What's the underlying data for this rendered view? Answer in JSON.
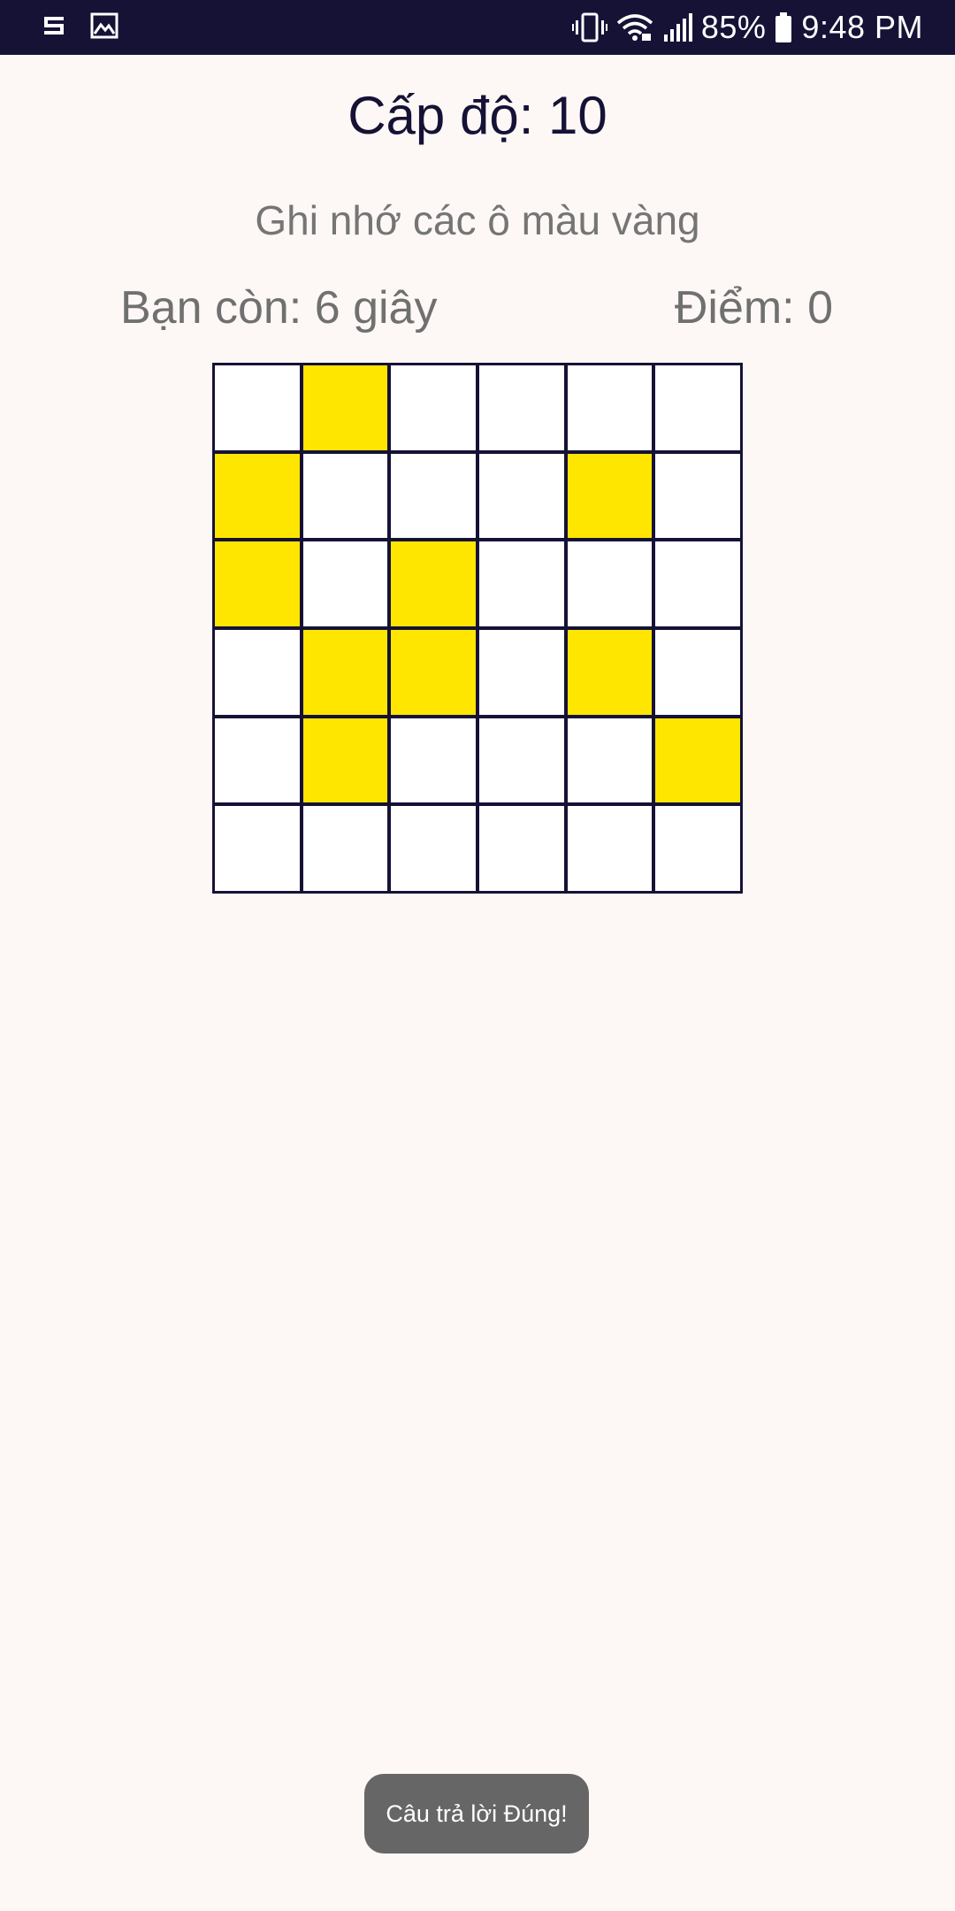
{
  "status_bar": {
    "left_icons": [
      "cast-icon",
      "image-icon"
    ],
    "right_icons": [
      "vibrate-icon",
      "wifi-icon",
      "signal-icon"
    ],
    "battery": "85%",
    "time": "9:48 PM"
  },
  "game": {
    "level_title": "Cấp độ: 10",
    "instruction": "Ghi nhớ các ô màu vàng",
    "timer": "Bạn còn: 6 giây",
    "score": "Điểm: 0",
    "grid_size": 6,
    "highlight_color": "#ffe600",
    "grid": [
      [
        0,
        1,
        0,
        0,
        0,
        0
      ],
      [
        1,
        0,
        0,
        0,
        1,
        0
      ],
      [
        1,
        0,
        1,
        0,
        0,
        0
      ],
      [
        0,
        1,
        1,
        0,
        1,
        0
      ],
      [
        0,
        1,
        0,
        0,
        0,
        1
      ],
      [
        0,
        0,
        0,
        0,
        0,
        0
      ]
    ]
  },
  "toast": {
    "message": "Câu trả lời Đúng!"
  },
  "colors": {
    "background": "#fdf8f6",
    "status_bar": "#161236",
    "grid_line": "#161236",
    "title_text": "#161236",
    "secondary_text": "#757575"
  }
}
